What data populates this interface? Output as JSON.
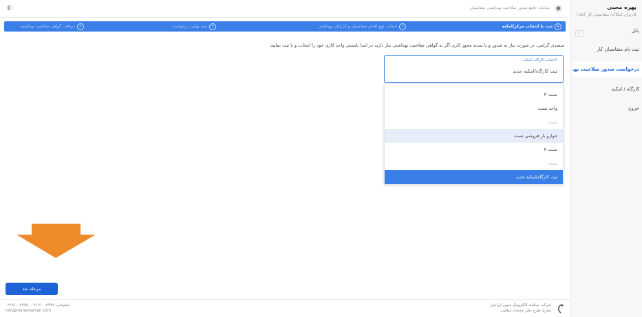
{
  "sidebar": {
    "user_name": "پهره محبی",
    "user_role": "کاربران امکاک/ متقاضیان کار (فک)",
    "collapse_icon": "chevron-icon",
    "items": [
      {
        "label": "پانل"
      },
      {
        "label": "ثبت نام متقاضیان کار"
      },
      {
        "label": "درخواست صدور صلاحیت بهداشتی"
      },
      {
        "label": "کارگاه / امکنه"
      },
      {
        "label": "خروج"
      }
    ]
  },
  "header": {
    "breadcrumb": "سامانه جامع صدور صلاحیت بهداشتی متقاضیان",
    "notification_icon": "bell-icon"
  },
  "steps": [
    {
      "num": "۱",
      "label": "ثبت یا انتخاب مرکز/امکنه"
    },
    {
      "num": "۲",
      "label": "انتخاب نوع اقدام متقاضیان و کارکنان بهداشتی"
    },
    {
      "num": "۳",
      "label": "ثبت نهایی درخواست"
    },
    {
      "num": "۴",
      "label": "دریافت گواهی صلاحیت بهداشتی"
    }
  ],
  "notice": "متصدی گرامی، در صورت نیاز به صدور و یا تمدید مجوز کاری اگر به گواهی صلاحیت بهداشتی نیاز دارید در ابتدا بایستی واحد کاری خود را انتخاب و یا ثبت نمایید.",
  "select": {
    "label": "*انتخاب کارگاه /امکنه",
    "value": "ثبت کارگاه/امکنه جدید"
  },
  "dropdown": [
    {
      "label": "تست ۳",
      "state": "normal"
    },
    {
      "label": "واحد تست",
      "state": "normal"
    },
    {
      "label": "تست",
      "state": "faded"
    },
    {
      "label": "خوارو بار فروشی تست",
      "state": "hover"
    },
    {
      "label": "تست ۴",
      "state": "normal"
    },
    {
      "label": "تست",
      "state": "faded"
    },
    {
      "label": "ثبت کارگاه/امکنه جدید",
      "state": "selected"
    }
  ],
  "next_button": "مرحله بعد",
  "footer": {
    "company": "شرکت سامانه الکترونیک سپین ایرانیان",
    "company_sub": "مجری طرح دفتر خدمات سلامت",
    "support": "پشتیبانی: ۰۲۱۹۱۰۰۲۹۹۹ - ۰۲۱۹۱۰۰۲۹۹۸",
    "email": "info@mohemarvan.com"
  },
  "colors": {
    "primary": "#3a7ee8",
    "button": "#1e63d6",
    "arrow": "#ef8a2b"
  }
}
